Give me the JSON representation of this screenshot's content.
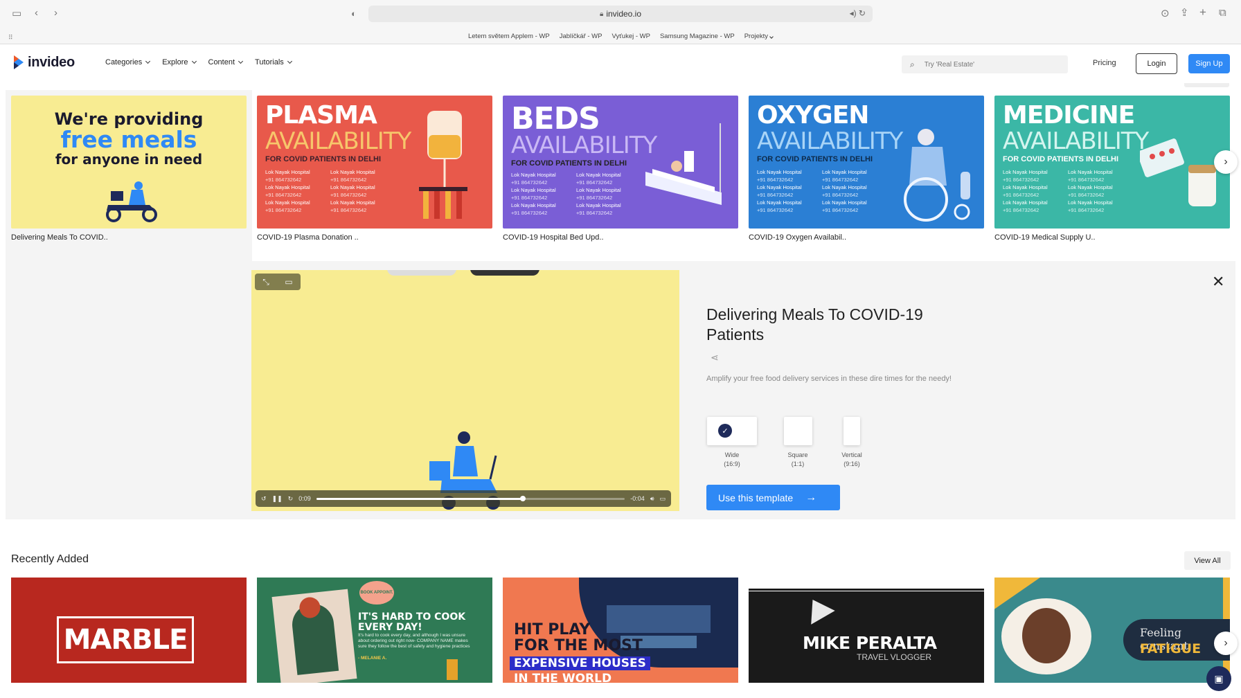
{
  "browser": {
    "url": "invideo.io",
    "bookmarks": [
      "Letem světem Applem - WP",
      "Jablíčkář - WP",
      "Vyťukej - WP",
      "Samsung Magazine - WP",
      "Projekty"
    ]
  },
  "nav": {
    "logo_text": "invideo",
    "menu": [
      "Categories",
      "Explore",
      "Content",
      "Tutorials"
    ],
    "search_placeholder": "Try 'Real Estate'",
    "pricing": "Pricing",
    "login": "Login",
    "signup": "Sign Up"
  },
  "templates": [
    {
      "title": "Delivering Meals To COVID..",
      "poster": {
        "line1": "We're providing",
        "line2": "free meals",
        "line3": "for anyone in need"
      }
    },
    {
      "title": "COVID-19 Plasma Donation ..",
      "poster": {
        "word": "PLASMA",
        "sub": "AVAILABILITY",
        "tag": "FOR COVID PATIENTS IN DELHI"
      }
    },
    {
      "title": "COVID-19 Hospital Bed Upd..",
      "poster": {
        "word": "BEDS",
        "sub": "AVAILABILITY",
        "tag": "FOR COVID PATIENTS IN DELHI"
      }
    },
    {
      "title": "COVID-19 Oxygen Availabil..",
      "poster": {
        "word": "OXYGEN",
        "sub": "AVAILABILITY",
        "tag": "FOR COVID PATIENTS IN DELHI"
      }
    },
    {
      "title": "COVID-19 Medical Supply U..",
      "poster": {
        "word": "MEDICINE",
        "sub": "AVAILABILITY",
        "tag": "FOR COVID PATIENTS IN DELHI"
      }
    }
  ],
  "hospital": {
    "name": "Lok Nayak Hospital",
    "phone": "+91 864732642"
  },
  "detail": {
    "title": "Delivering Meals To COVID-19 Patients",
    "description": "Amplify your free food delivery services in these dire times for the needy!",
    "ratios": [
      {
        "label": "Wide",
        "sub": "(16:9)",
        "selected": true
      },
      {
        "label": "Square",
        "sub": "(1:1)",
        "selected": false
      },
      {
        "label": "Vertical",
        "sub": "(9:16)",
        "selected": false
      }
    ],
    "cta": "Use this template",
    "player": {
      "elapsed": "0:09",
      "remaining": "-0:04",
      "progress": 0.67
    }
  },
  "recent": {
    "heading": "Recently Added",
    "view_all": "View All",
    "cards": [
      {
        "text": "MARBLE"
      },
      {
        "text": "IT'S HARD TO COOK EVERY DAY!",
        "small": "It's hard to cook every day, and although I was unsure about ordering out right now- COMPANY NAME makes sure they follow the best of safety and hygiene practices",
        "author": "- MELANIE A.",
        "badge": "BOOK APPOINT."
      },
      {
        "line1": "HIT PLAY",
        "line2": "FOR THE MOST",
        "line3": "EXPENSIVE HOUSES",
        "line4": "IN THE WORLD"
      },
      {
        "name": "MIKE PERALTA",
        "role": "TRAVEL VLOGGER"
      },
      {
        "line1": "Feeling constant",
        "line2": "FATIGUE"
      }
    ]
  },
  "colors": {
    "accent": "#2f89f5",
    "dark_navy": "#1e2a5a",
    "yellow": "#f8ec92"
  }
}
